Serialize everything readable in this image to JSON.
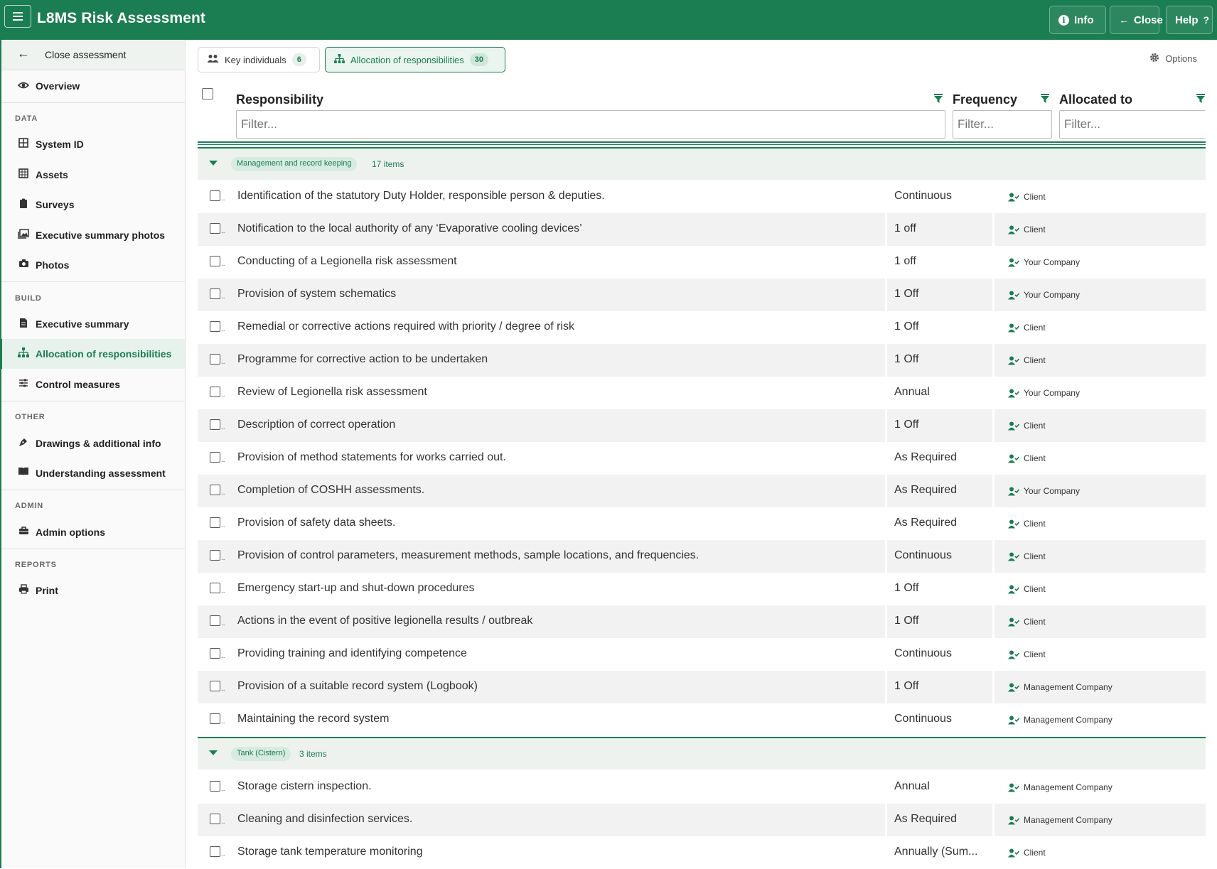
{
  "app": {
    "title": "L8MS Risk Assessment"
  },
  "top_buttons": {
    "info": "Info",
    "close": "Close",
    "help": "Help"
  },
  "sidebar": {
    "close_label": "Close assessment",
    "overview": "Overview",
    "sections": {
      "data": "DATA",
      "build": "BUILD",
      "other": "OTHER",
      "admin": "ADMIN",
      "reports": "REPORTS"
    },
    "items": {
      "system_id": "System ID",
      "assets": "Assets",
      "surveys": "Surveys",
      "exec_photos": "Executive summary photos",
      "photos": "Photos",
      "exec_summary": "Executive summary",
      "allocation": "Allocation of responsibilities",
      "control_measures": "Control measures",
      "drawings": "Drawings & additional info",
      "understanding": "Understanding assessment",
      "admin_options": "Admin options",
      "print": "Print"
    }
  },
  "tabs": [
    {
      "label": "Key individuals",
      "count": "6"
    },
    {
      "label": "Allocation of responsibilities",
      "count": "30"
    }
  ],
  "options_label": "Options",
  "table": {
    "columns": {
      "responsibility": "Responsibility",
      "frequency": "Frequency",
      "allocated": "Allocated to"
    },
    "filter_placeholder": "Filter...",
    "groups": [
      {
        "name": "Management and record keeping",
        "count_label": "17 items"
      },
      {
        "name": "Tank (Cistern)",
        "count_label": "3 items"
      }
    ],
    "rows": [
      {
        "responsibility": "Identification of the statutory Duty Holder, responsible person & deputies.",
        "frequency": "Continuous",
        "allocated": "Client"
      },
      {
        "responsibility": "Notification to the local authority of any ‘Evaporative cooling devices’",
        "frequency": "1 off",
        "allocated": "Client"
      },
      {
        "responsibility": "Conducting of a Legionella risk assessment",
        "frequency": "1 off",
        "allocated": "Your Company"
      },
      {
        "responsibility": "Provision of system schematics",
        "frequency": "1 Off",
        "allocated": "Your Company"
      },
      {
        "responsibility": "Remedial or corrective actions required with priority / degree of risk",
        "frequency": "1 Off",
        "allocated": "Client"
      },
      {
        "responsibility": "Programme for corrective action to be undertaken",
        "frequency": "1 Off",
        "allocated": "Client"
      },
      {
        "responsibility": "Review of Legionella risk assessment",
        "frequency": "Annual",
        "allocated": "Your Company"
      },
      {
        "responsibility": "Description of correct operation",
        "frequency": "1 Off",
        "allocated": "Client"
      },
      {
        "responsibility": "Provision of method statements for works carried out.",
        "frequency": "As Required",
        "allocated": "Client"
      },
      {
        "responsibility": "Completion of COSHH assessments.",
        "frequency": "As Required",
        "allocated": "Your Company"
      },
      {
        "responsibility": "Provision of safety data sheets.",
        "frequency": "As Required",
        "allocated": "Client"
      },
      {
        "responsibility": "Provision of control parameters, measurement methods, sample locations, and frequencies.",
        "frequency": "Continuous",
        "allocated": "Client"
      },
      {
        "responsibility": "Emergency start-up and shut-down procedures",
        "frequency": "1 Off",
        "allocated": "Client"
      },
      {
        "responsibility": "Actions in the event of positive legionella results / outbreak",
        "frequency": "1 Off",
        "allocated": "Client"
      },
      {
        "responsibility": "Providing training and identifying competence",
        "frequency": "Continuous",
        "allocated": "Client"
      },
      {
        "responsibility": "Provision of a suitable record system (Logbook)",
        "frequency": "1 Off",
        "allocated": "Management Company"
      },
      {
        "responsibility": "Maintaining the record system",
        "frequency": "Continuous",
        "allocated": "Management Company"
      },
      {
        "responsibility": "Storage cistern inspection.",
        "frequency": "Annual",
        "allocated": "Management Company"
      },
      {
        "responsibility": "Cleaning and disinfection services.",
        "frequency": "As Required",
        "allocated": "Management Company"
      },
      {
        "responsibility": "Storage tank temperature monitoring",
        "frequency": "Annually (Sum...",
        "allocated": "Client"
      }
    ]
  }
}
